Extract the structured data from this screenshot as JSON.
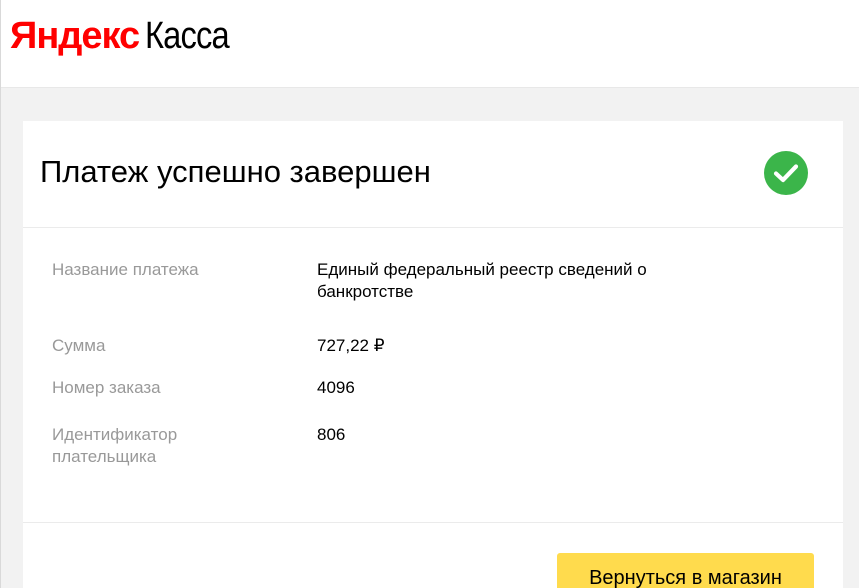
{
  "header": {
    "logo_brand": "Яндекс",
    "logo_product": "Касса"
  },
  "card": {
    "title": "Платеж успешно завершен",
    "status_icon": "check-circle-icon",
    "rows": [
      {
        "label": "Название платежа",
        "value": "Единый федеральный реестр сведений о банкротстве"
      },
      {
        "label": "Сумма",
        "value": "727,22 ₽"
      },
      {
        "label": "Номер заказа",
        "value": "4096"
      },
      {
        "label": "Идентификатор плательщика",
        "value": "806"
      }
    ],
    "return_button_label": "Вернуться в магазин"
  },
  "colors": {
    "brand_red": "#ff0000",
    "success_green": "#3bb54a",
    "button_yellow": "#ffdb4d",
    "label_gray": "#999999",
    "page_background": "#f2f2f2"
  }
}
